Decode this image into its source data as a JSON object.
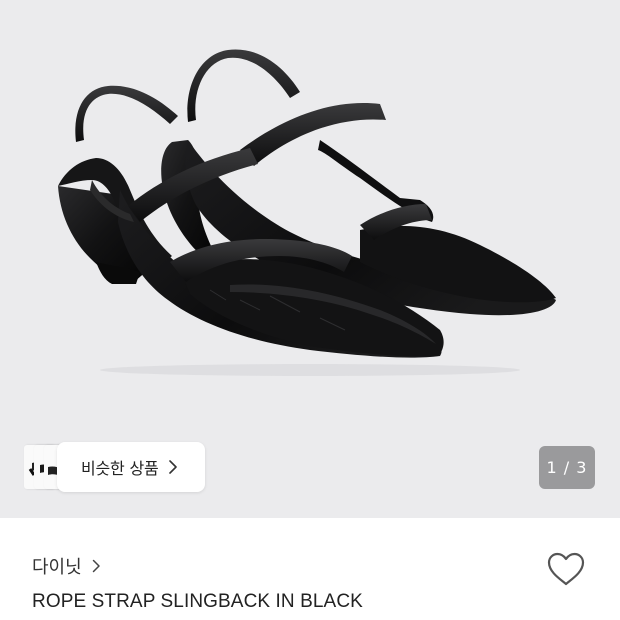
{
  "gallery": {
    "image_alt": "black pointed-toe slingback heels with crossed straps",
    "similar_products_label": "비슷한 상품",
    "page_indicator": "1 / 3",
    "current_page": 1,
    "total_pages": 3
  },
  "product": {
    "brand": "다이닛",
    "title": "ROPE STRAP SLINGBACK IN BLACK",
    "liked": false
  },
  "icons": {
    "similar_chevron": "chevron-right-icon",
    "brand_chevron": "chevron-right-icon",
    "favorite": "heart-outline-icon"
  },
  "colors": {
    "image_background": "#ebebed",
    "indicator_background": "#9a9a9c",
    "text_primary": "#222222",
    "heart_stroke": "#555555"
  }
}
